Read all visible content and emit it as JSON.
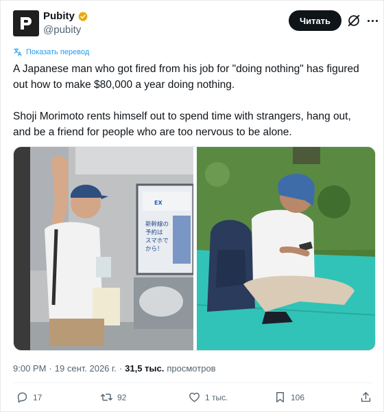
{
  "author": {
    "display_name": "Pubity",
    "handle": "@pubity",
    "verified_icon": "verified-badge-icon",
    "avatar_icon": "pubity-logo-icon"
  },
  "follow_label": "Читать",
  "translate_label": "Показать перевод",
  "tweet": {
    "paragraph1": "A Japanese man who got fired from his job for \"doing nothing\" has figured out how to make $80,000 a year doing nothing.",
    "paragraph2": "Shoji Morimoto rents himself out to spend time with strangers, hang out, and be a friend for people who are too nervous to be alone."
  },
  "media": {
    "photo_left_sign": "新幹線の\n予約は\nスマホで\nから！",
    "photo_left_banner": "EX"
  },
  "meta": {
    "time": "9:00 PM",
    "separator": "·",
    "date": "19 сент. 2026 г.",
    "views_count": "31,5 тыс.",
    "views_label": "просмотров"
  },
  "actions": {
    "replies": "17",
    "reposts": "92",
    "likes": "1 тыс.",
    "bookmarks": "106"
  },
  "colors": {
    "accent": "#1d9bf0",
    "text": "#0f1419",
    "muted": "#536471",
    "verified": "#e8a90c"
  }
}
